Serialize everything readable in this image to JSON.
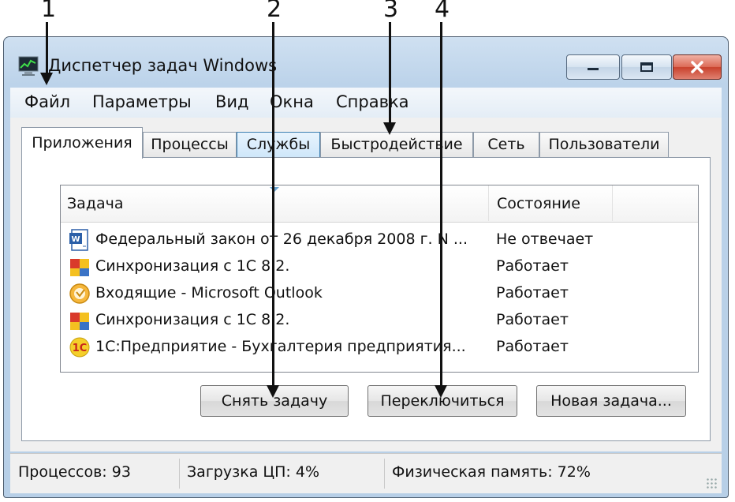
{
  "window": {
    "title": "Диспетчер задач Windows"
  },
  "menu": [
    "Файл",
    "Параметры",
    "Вид",
    "Окна",
    "Справка"
  ],
  "tabs": [
    "Приложения",
    "Процессы",
    "Службы",
    "Быстродействие",
    "Сеть",
    "Пользователи"
  ],
  "list": {
    "col_task": "Задача",
    "col_state": "Состояние",
    "rows": [
      {
        "icon": "word-doc-icon",
        "name": "Федеральный закон от 26 декабря 2008 г. N ...",
        "state": "Не отвечает"
      },
      {
        "icon": "1c-sync-icon",
        "name": "Синхронизация с 1С 8.2.",
        "state": "Работает"
      },
      {
        "icon": "outlook-icon",
        "name": "Входящие - Microsoft Outlook",
        "state": "Работает"
      },
      {
        "icon": "1c-sync-icon",
        "name": "Синхронизация с 1С 8.2.",
        "state": "Работает"
      },
      {
        "icon": "1c-enterprise-icon",
        "name": "1С:Предприятие - Бухгалтерия предприятия...",
        "state": "Работает"
      }
    ]
  },
  "buttons": {
    "end_task": "Снять задачу",
    "switch_to": "Переключиться",
    "new_task": "Новая задача..."
  },
  "status": {
    "processes": "Процессов: 93",
    "cpu": "Загрузка ЦП: 4%",
    "memory": "Физическая память: 72%"
  },
  "callouts": [
    "1",
    "2",
    "3",
    "4"
  ]
}
